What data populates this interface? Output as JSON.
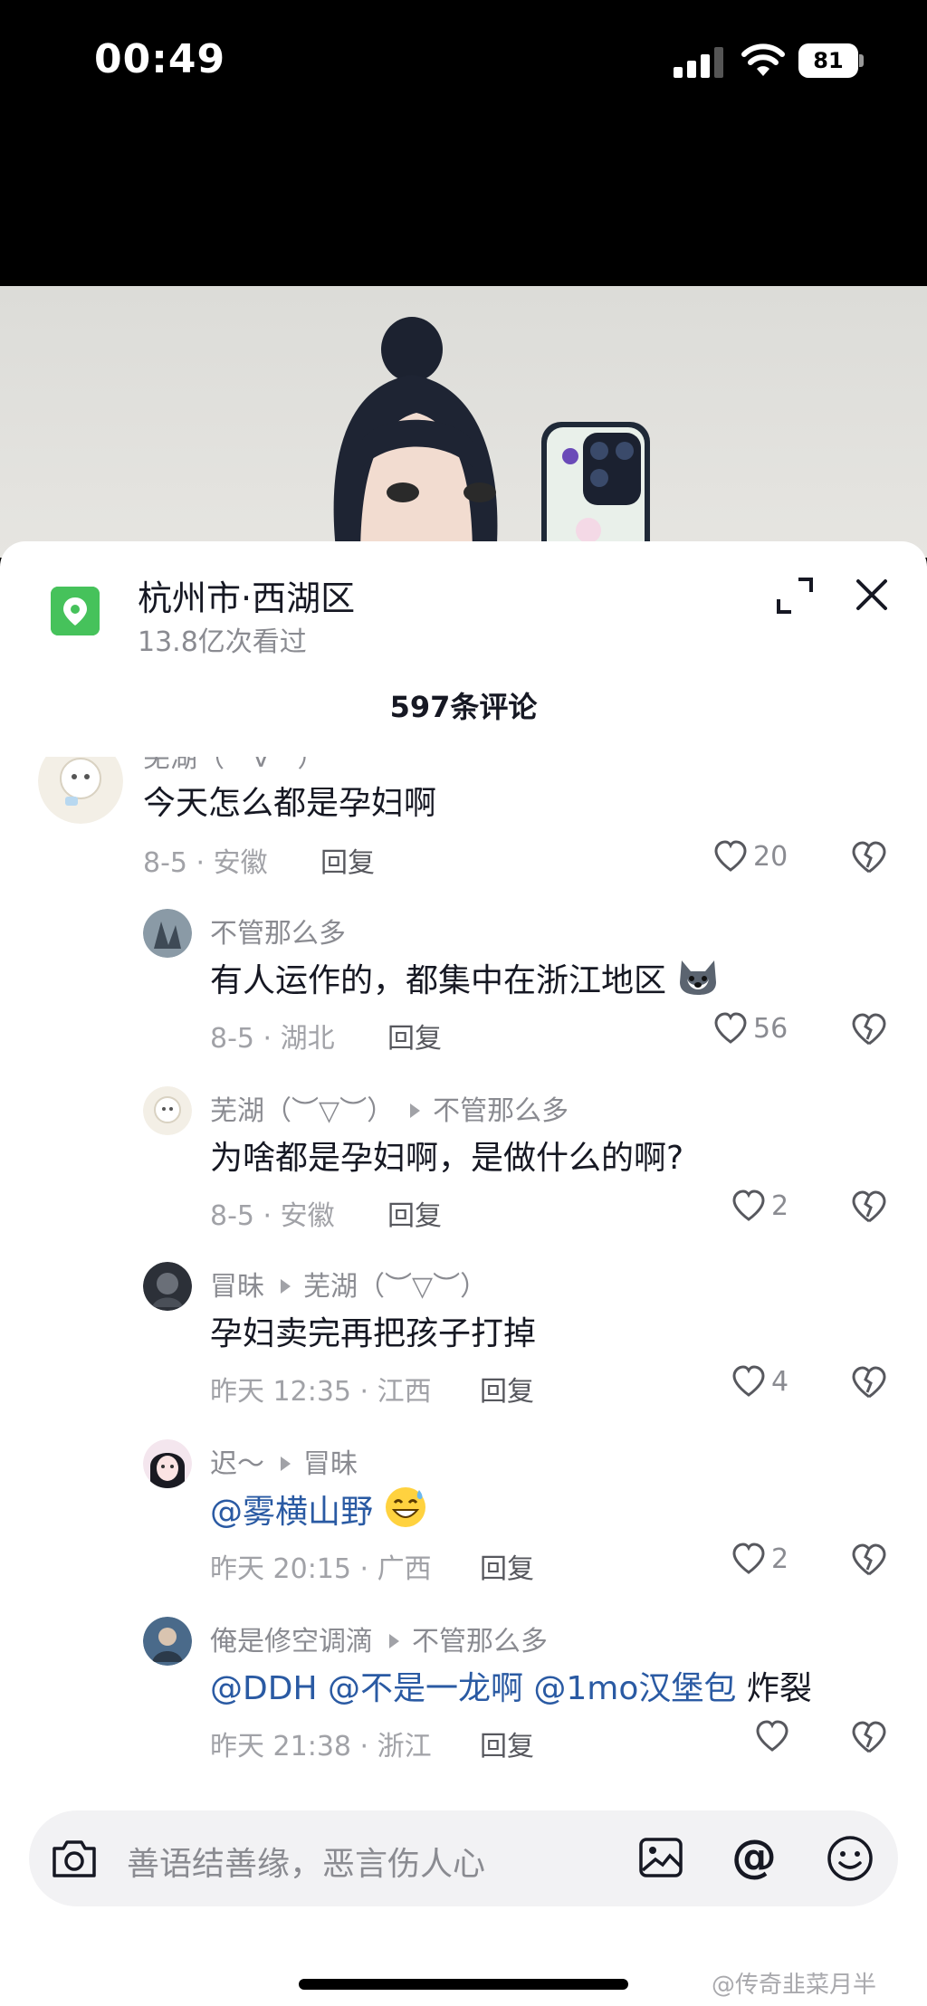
{
  "status_bar": {
    "time": "00:49",
    "battery": "81"
  },
  "sheet": {
    "location_title": "杭州市·西湖区",
    "location_subtitle": "13.8亿次看过",
    "comment_count": "597条评论"
  },
  "comments": [
    {
      "name": "芜湖（︶∀︶）",
      "text": "今天怎么都是孕妇啊",
      "meta": "8-5 · 安徽",
      "reply": "回复",
      "likes": "20"
    },
    {
      "name": "不管那么多",
      "text": "有人运作的，都集中在浙江地区",
      "meta": "8-5 · 湖北",
      "reply": "回复",
      "likes": "56"
    },
    {
      "name": "芜湖（︶▽︶）",
      "reply_to": "不管那么多",
      "text": "为啥都是孕妇啊，是做什么的啊?",
      "meta": "8-5 · 安徽",
      "reply": "回复",
      "likes": "2"
    },
    {
      "name": "冒昧",
      "reply_to": "芜湖（︶▽︶）",
      "text": "孕妇卖完再把孩子打掉",
      "meta": "昨天 12:35 · 江西",
      "reply": "回复",
      "likes": "4"
    },
    {
      "name": "迟～",
      "reply_to": "冒昧",
      "text": "@雾横山野",
      "meta": "昨天 20:15 · 广西",
      "reply": "回复",
      "likes": "2"
    },
    {
      "name": "俺是修空调滴",
      "reply_to": "不管那么多",
      "text_mentions": "@DDH @不是一龙啊 @1mo汉堡包",
      "text_plain": " 炸裂",
      "meta": "昨天 21:38 · 浙江",
      "reply": "回复",
      "likes": ""
    }
  ],
  "input": {
    "placeholder": "善语结善缘，恶言伤人心"
  },
  "watermark": "@传奇韭菜月半"
}
